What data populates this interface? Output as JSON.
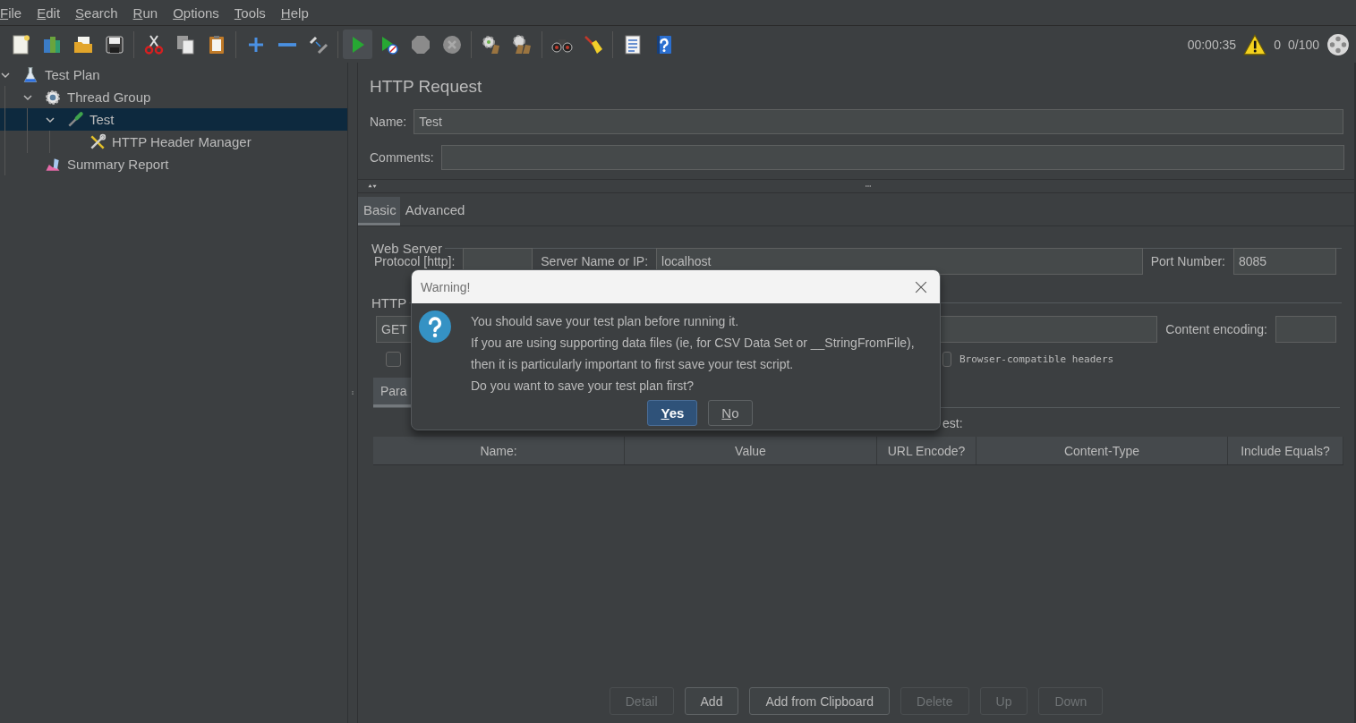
{
  "menu": [
    {
      "label": "File",
      "mnemonic": true
    },
    {
      "label": "Edit",
      "mnemonic": true
    },
    {
      "label": "Search",
      "mnemonic": true
    },
    {
      "label": "Run",
      "mnemonic": true
    },
    {
      "label": "Options",
      "mnemonic": true
    },
    {
      "label": "Tools",
      "mnemonic": true
    },
    {
      "label": "Help",
      "mnemonic": true
    }
  ],
  "toolbar": {
    "buttons": [
      {
        "kind": "new",
        "pressed": false
      },
      {
        "kind": "templates",
        "pressed": false
      },
      {
        "kind": "open",
        "pressed": false
      },
      {
        "kind": "save",
        "pressed": false
      },
      {
        "kind": "separator"
      },
      {
        "kind": "cut",
        "pressed": false
      },
      {
        "kind": "copy",
        "pressed": false
      },
      {
        "kind": "paste",
        "pressed": false
      },
      {
        "kind": "separator"
      },
      {
        "kind": "expand",
        "pressed": false
      },
      {
        "kind": "collapse",
        "pressed": false
      },
      {
        "kind": "toggle",
        "pressed": false
      },
      {
        "kind": "separator"
      },
      {
        "kind": "start",
        "pressed": true
      },
      {
        "kind": "start-no-pause",
        "pressed": false
      },
      {
        "kind": "stop",
        "pressed": false
      },
      {
        "kind": "shutdown",
        "pressed": false
      },
      {
        "kind": "separator"
      },
      {
        "kind": "clear",
        "pressed": false
      },
      {
        "kind": "clear-all",
        "pressed": false
      },
      {
        "kind": "separator"
      },
      {
        "kind": "search",
        "pressed": false
      },
      {
        "kind": "reset-search",
        "pressed": false
      },
      {
        "kind": "separator"
      },
      {
        "kind": "functions",
        "pressed": false
      },
      {
        "kind": "help",
        "pressed": false
      }
    ],
    "status": {
      "elapsed": "00:00:35",
      "warnings": "0",
      "threads": "0/100"
    }
  },
  "tree": [
    {
      "label": "Test Plan",
      "kind": "plan",
      "expanded": true,
      "selected": false,
      "children": [
        {
          "label": "Thread Group",
          "kind": "thread-group",
          "expanded": true,
          "selected": false,
          "children": [
            {
              "label": "Test",
              "kind": "sampler",
              "expanded": true,
              "selected": true,
              "children": [
                {
                  "label": "HTTP Header Manager",
                  "kind": "config",
                  "selected": false
                }
              ]
            }
          ]
        },
        {
          "label": "Summary Report",
          "kind": "listener",
          "selected": false
        }
      ]
    }
  ],
  "editor": {
    "title": "HTTP Request",
    "name_label": "Name:",
    "name_value": "Test",
    "comments_label": "Comments:",
    "tabs": [
      {
        "label": "Basic",
        "selected": true
      },
      {
        "label": "Advanced",
        "selected": false
      }
    ],
    "web_server": {
      "legend": "Web Server",
      "protocol_label": "Protocol [http]:",
      "server_label": "Server Name or IP:",
      "server_value": "localhost",
      "port_label": "Port Number:",
      "port_value": "8085"
    },
    "http_request": {
      "legend": "HTTP",
      "method": "GET",
      "encoding_label": "Content encoding:",
      "first_checkbox": {
        "checked": false
      },
      "browser_headers": {
        "label": "Browser-compatible headers",
        "checked": false
      }
    },
    "parameters": {
      "tab": "Para",
      "send_label": "est:",
      "columns": [
        "Name:",
        "Value",
        "URL Encode?",
        "Content-Type",
        "Include Equals?"
      ]
    },
    "buttons": [
      {
        "label": "Detail",
        "disabled": true
      },
      {
        "label": "Add",
        "disabled": false
      },
      {
        "label": "Add from Clipboard",
        "disabled": false
      },
      {
        "label": "Delete",
        "disabled": true
      },
      {
        "label": "Up",
        "disabled": true
      },
      {
        "label": "Down",
        "disabled": true
      }
    ]
  },
  "dialog": {
    "title": "Warning!",
    "lines": [
      "You should save your test plan before running it.",
      "If you are using supporting data files (ie, for CSV Data Set or __StringFromFile),",
      "then it is particularly important to first save your test script.",
      "Do you want to save your test plan first?"
    ],
    "buttons": [
      {
        "label": "Yes",
        "mnemonic": true,
        "default": true
      },
      {
        "label": "No",
        "mnemonic": true,
        "default": false
      }
    ]
  }
}
